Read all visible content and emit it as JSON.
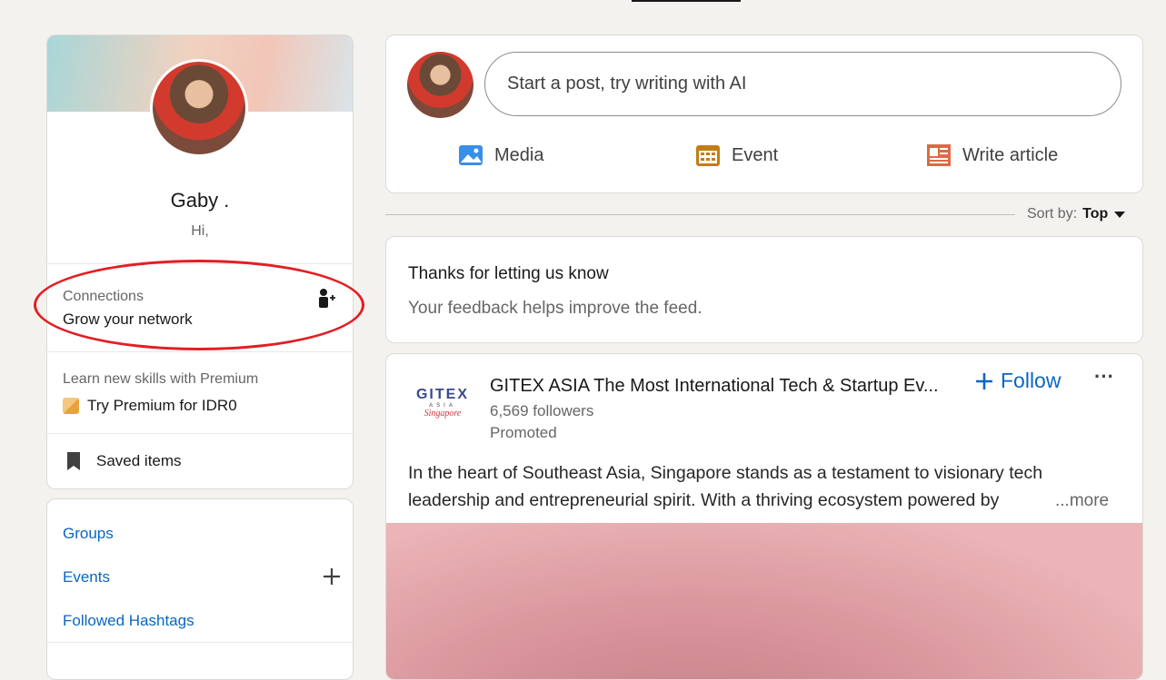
{
  "profile": {
    "name": "Gaby .",
    "headline": "Hi,",
    "connections_label": "Connections",
    "connections_action": "Grow your network",
    "premium_prompt": "Learn new skills with Premium",
    "premium_cta": "Try Premium for IDR0",
    "saved_items": "Saved items"
  },
  "shortcuts": {
    "groups": "Groups",
    "events": "Events",
    "hashtags": "Followed Hashtags"
  },
  "composer": {
    "placeholder": "Start a post, try writing with AI",
    "media": "Media",
    "event": "Event",
    "article": "Write article"
  },
  "sort": {
    "label": "Sort by:",
    "value": "Top"
  },
  "feedback": {
    "title": "Thanks for letting us know",
    "body": "Your feedback helps improve the feed."
  },
  "post": {
    "author": "GITEX ASIA The Most International Tech & Startup Ev...",
    "logo_text": "GITEX ASIA Singapore",
    "followers": "6,569 followers",
    "promoted": "Promoted",
    "follow": "Follow",
    "text_line1": "In the heart of Southeast Asia, Singapore stands as a testament to visionary tech",
    "text_line2": "leadership and entrepreneurial spirit. With a thriving ecosystem powered by",
    "more": "...more"
  },
  "colors": {
    "accent": "#0a66c2",
    "annotation": "#e31e24",
    "background": "#f4f2ee"
  }
}
